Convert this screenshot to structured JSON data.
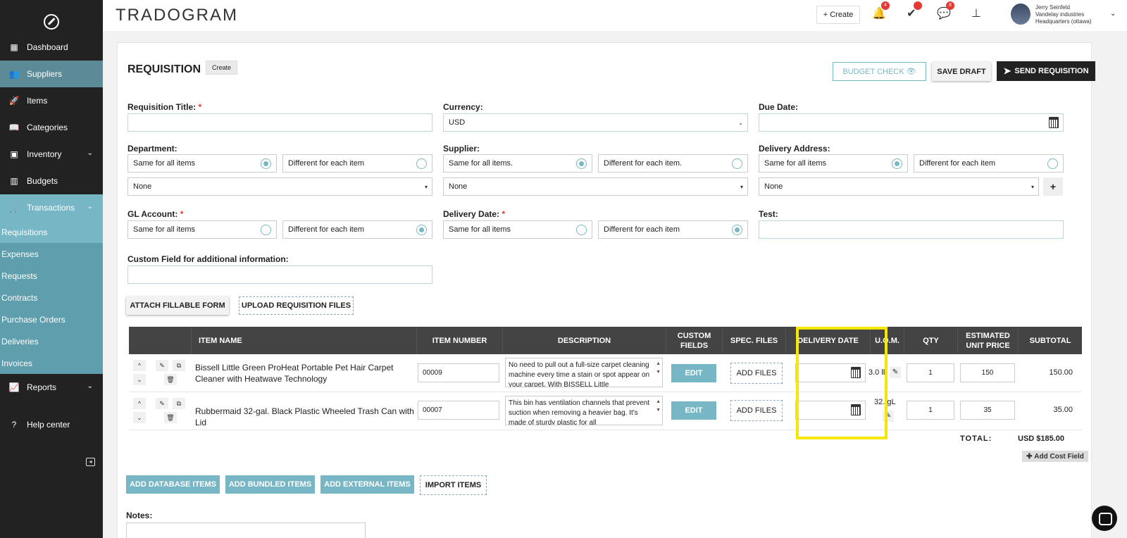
{
  "app": {
    "brand": "TRADOGRAM"
  },
  "sidebar": {
    "items": [
      {
        "label": "Dashboard",
        "icon": "dashboard-icon"
      },
      {
        "label": "Suppliers",
        "icon": "users-icon"
      },
      {
        "label": "Items",
        "icon": "rocket-icon"
      },
      {
        "label": "Categories",
        "icon": "book-icon"
      },
      {
        "label": "Inventory",
        "icon": "inbox-icon"
      },
      {
        "label": "Budgets",
        "icon": "bar-chart-icon"
      },
      {
        "label": "Transactions",
        "icon": "cart-icon"
      }
    ],
    "sub_items": [
      "Requisitions",
      "Expenses",
      "Requests",
      "Contracts",
      "Purchase Orders",
      "Deliveries",
      "Invoices"
    ],
    "reports": "Reports",
    "help": "Help center"
  },
  "topbar": {
    "create_label": "+ Create",
    "notif_count": "4",
    "msg_count": "8",
    "user_name": "Jerry Seinfeld",
    "user_company": "Vandelay industries",
    "user_location": "Headquarters (ottawa)"
  },
  "page": {
    "title": "REQUISITION",
    "chip": "Create",
    "budget_check": "BUDGET CHECK",
    "save_draft": "SAVE DRAFT",
    "send_requisition": "SEND REQUISITION"
  },
  "form": {
    "requisition_title": "Requisition Title:",
    "currency": "Currency:",
    "currency_value": "USD",
    "due_date": "Due Date:",
    "department": "Department:",
    "supplier": "Supplier:",
    "delivery_address": "Delivery Address:",
    "same_all": "Same for all items",
    "diff_each": "Different for each item",
    "same_all_dot": "Same for all items.",
    "diff_each_dot": "Different for each item.",
    "none": "None",
    "gl_account": "GL Account:",
    "delivery_date": "Delivery Date:",
    "test": "Test:",
    "custom_field": "Custom Field for additional information:",
    "attach_form": "ATTACH FILLABLE FORM",
    "upload_files": "UPLOAD REQUISITION FILES"
  },
  "table": {
    "headers": [
      "ITEM NAME",
      "ITEM NUMBER",
      "DESCRIPTION",
      "CUSTOM FIELDS",
      "SPEC. FILES",
      "DELIVERY DATE",
      "U.O.M.",
      "QTY",
      "ESTIMATED UNIT PRICE",
      "SUBTOTAL"
    ],
    "rows": [
      {
        "name": "Bissell Little Green ProHeat Portable Pet Hair Carpet Cleaner with Heatwave Technology",
        "number": "00009",
        "description": "No need to pull out a full-size carpet cleaning machine every time a stain or spot appear on your carpet. With BISSELL Little",
        "uom": "3.0 lb",
        "qty": "1",
        "price": "150",
        "subtotal": "150.00"
      },
      {
        "name": "Rubbermaid 32-gal. Black Plastic Wheeled Trash Can with Lid",
        "number": "00007",
        "description": "This bin has ventilation channels that prevent suction when removing a heavier bag. It's made of sturdy plastic for all",
        "uom": "32. gL",
        "qty": "1",
        "price": "35",
        "subtotal": "35.00"
      }
    ],
    "edit_label": "EDIT",
    "add_files_label": "ADD FILES",
    "total_label": "TOTAL:",
    "total_value": "USD $185.00",
    "add_cost": "Add Cost Field"
  },
  "actions": {
    "add_database": "ADD DATABASE ITEMS",
    "add_bundled": "ADD BUNDLED ITEMS",
    "add_external": "ADD EXTERNAL ITEMS",
    "import": "IMPORT ITEMS"
  },
  "notes_label": "Notes:"
}
